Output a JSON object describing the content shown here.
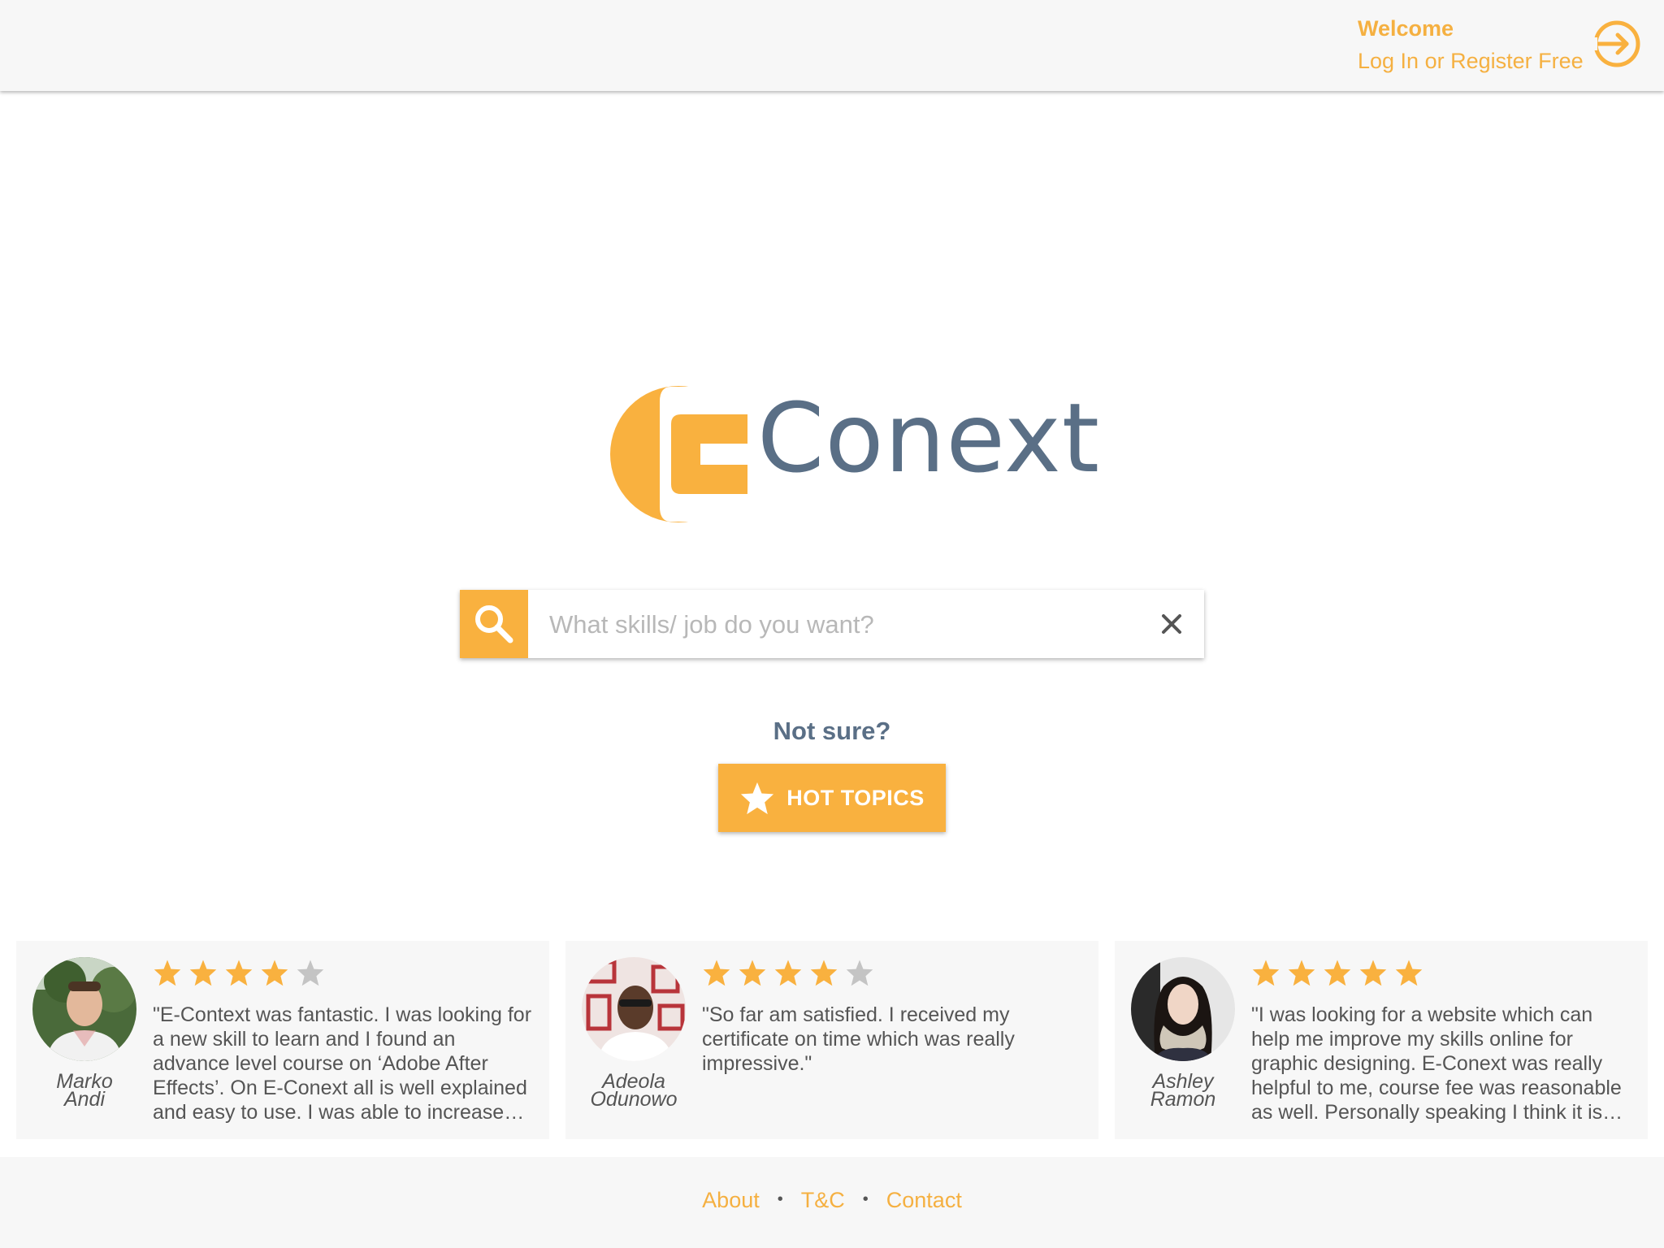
{
  "header": {
    "welcome": "Welcome",
    "login_link": "Log In or Register Free",
    "login_icon": "login-arrow-icon"
  },
  "logo": {
    "wordmark": "Conext",
    "letter": "E",
    "colors": {
      "orange": "#f9b13f",
      "slate": "#5a6f86"
    }
  },
  "search": {
    "placeholder": "What skills/ job do you want?",
    "value": "",
    "search_icon": "search-icon",
    "clear_icon": "close-icon"
  },
  "prompt": {
    "not_sure": "Not sure?",
    "hot_topics_label": "HOT TOPICS",
    "hot_topics_icon": "star-icon"
  },
  "reviews": [
    {
      "name_line1": "Marko",
      "name_line2": "Andi",
      "rating": 4,
      "text": "\"E-Context was fantastic. I was looking for a new skill to learn and I found an advance level course on ‘Adobe After Effects’. On E-Conext all is well explained and easy to use. I was able to increase my skills quickly.\""
    },
    {
      "name_line1": "Adeola",
      "name_line2": "Odunowo",
      "rating": 4,
      "text": "\"So far am satisfied. I received my certificate on time which was really impressive.\""
    },
    {
      "name_line1": "Ashley",
      "name_line2": "Ramon",
      "rating": 5,
      "text": "\"I was looking for a website which can help me improve my skills online for graphic designing. E-Conext was really helpful to me, course fee was reasonable as well. Personally speaking I think it is great.\""
    }
  ],
  "footer": {
    "links": [
      "About",
      "T&C",
      "Contact"
    ]
  },
  "colors": {
    "accent": "#f9b13f",
    "star_on": "#f9b13f",
    "star_off": "#c4c4c4",
    "panel_bg": "#f7f7f7"
  }
}
